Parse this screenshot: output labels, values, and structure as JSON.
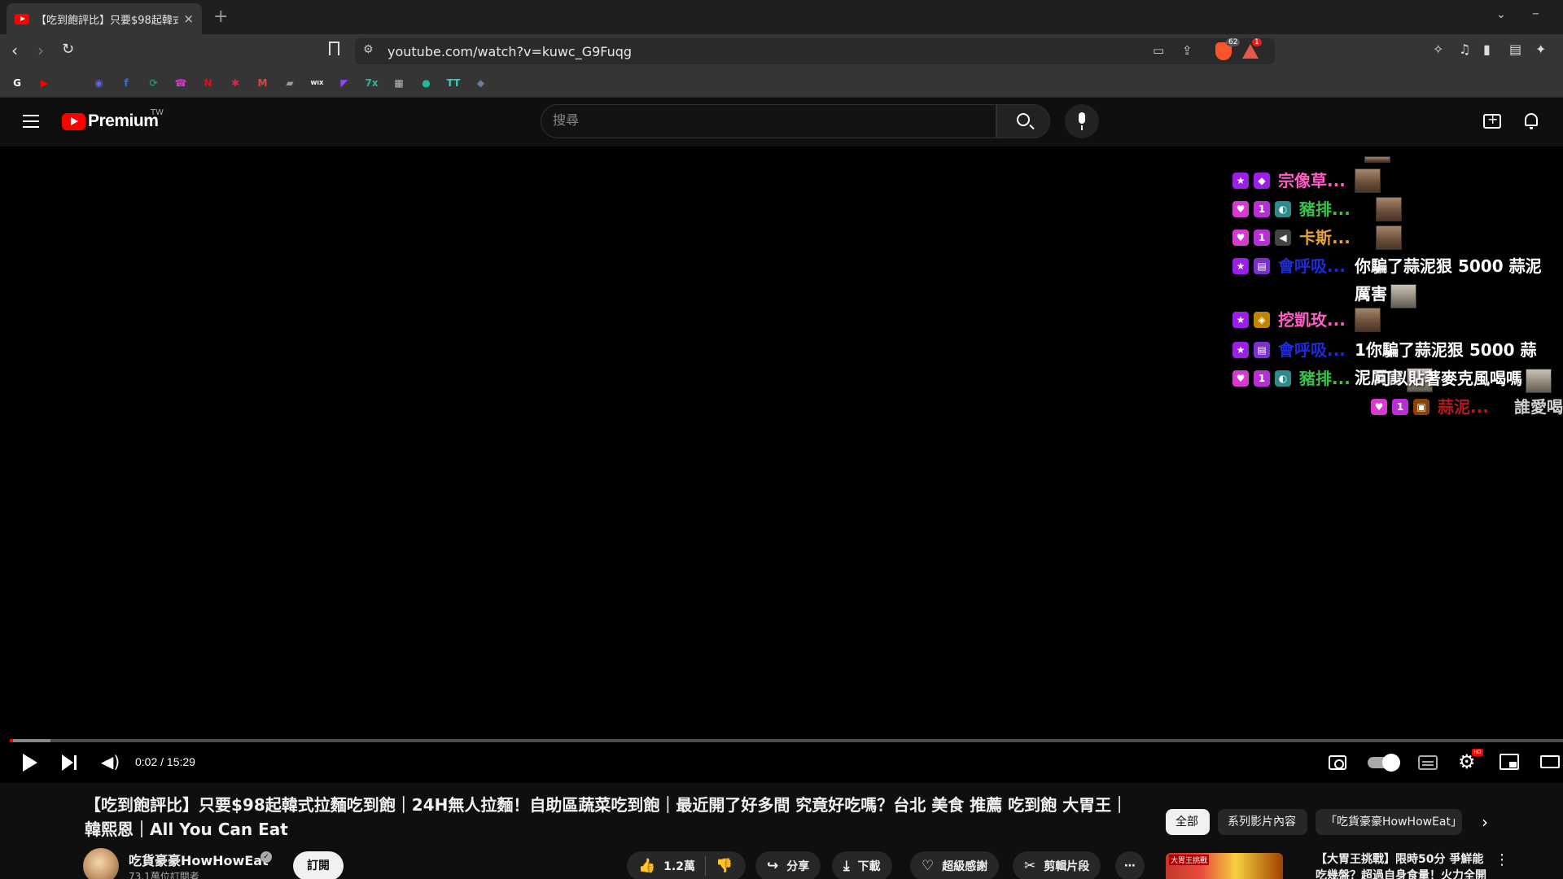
{
  "browser": {
    "tab_title": "【吃到飽評比】只要$98起韓式",
    "tab_close": "×",
    "new_tab": "+",
    "url": "youtube.com/watch?v=kuwc_G9Fuqg",
    "brave_shield_count": "62",
    "rewards_count": "1"
  },
  "bookmarks": [
    {
      "icon": "google-icon",
      "label": "G",
      "color": "#ffffff"
    },
    {
      "icon": "youtube-icon",
      "label": "▶",
      "color": "#ff0000"
    },
    {
      "icon": "app-icon",
      "label": "",
      "color": "#888888"
    },
    {
      "icon": "discord-icon",
      "label": "◉",
      "color": "#5865f2"
    },
    {
      "icon": "facebook-icon",
      "label": "f",
      "color": "#1877f2"
    },
    {
      "icon": "web-icon",
      "label": "⟳",
      "color": "#2f8f6f"
    },
    {
      "icon": "podcast-icon",
      "label": "☎",
      "color": "#d63acf"
    },
    {
      "icon": "netflix-icon",
      "label": "N",
      "color": "#e50914"
    },
    {
      "icon": "star-app-icon",
      "label": "✱",
      "color": "#e0244e"
    },
    {
      "icon": "gmail-icon",
      "label": "M",
      "color": "#ea4335"
    },
    {
      "icon": "drive-icon",
      "label": "▰",
      "color": "#9a9a9a"
    },
    {
      "icon": "wix-icon",
      "label": "WIX",
      "color": "#ffffff"
    },
    {
      "icon": "twitch-icon",
      "label": "◤",
      "color": "#9146ff"
    },
    {
      "icon": "tool-icon",
      "label": "7x",
      "color": "#1abc9c"
    },
    {
      "icon": "grid-icon",
      "label": "▦",
      "color": "#bbbbbb"
    },
    {
      "icon": "chat-icon",
      "label": "●",
      "color": "#1abc9c"
    },
    {
      "icon": "tt-icon",
      "label": "TT",
      "color": "#29d4c8"
    },
    {
      "icon": "shield-app-icon",
      "label": "◆",
      "color": "#6c7a9c"
    }
  ],
  "masthead": {
    "brand": "Premium",
    "region": "TW",
    "search_placeholder": "搜尋"
  },
  "chat": [
    {
      "badges": [
        "star",
        "diamond"
      ],
      "name": "宗像草...",
      "name_color": "pink",
      "message": "",
      "emote": true
    },
    {
      "badges": [
        "heart",
        "first",
        "pony"
      ],
      "name": "豬排...",
      "name_color": "green",
      "message": "",
      "emote": true
    },
    {
      "badges": [
        "heart",
        "first",
        "mute"
      ],
      "name": "卡斯...",
      "name_color": "orange",
      "message": "",
      "emote": true
    },
    {
      "badges": [
        "star",
        "sub"
      ],
      "name": "會呼吸...",
      "name_color": "blue",
      "message": "你騙了蒜泥狠 5000 蒜泥厲害",
      "emote": true
    },
    {
      "badges": [
        "star",
        "gold"
      ],
      "name": "挖凱玫...",
      "name_color": "pink",
      "message": "",
      "emote": true
    },
    {
      "badges": [
        "star",
        "sub"
      ],
      "name": "會呼吸...",
      "name_color": "blue",
      "message": "1你騙了蒜泥狠 5000 蒜泥厲害",
      "emote": true
    },
    {
      "badges": [
        "heart",
        "first",
        "pony"
      ],
      "name": "豬排...",
      "name_color": "green",
      "message": "可以貼著麥克風喝嗎",
      "emote": true
    },
    {
      "badges": [
        "heart",
        "first",
        "box"
      ],
      "name": "蒜泥...",
      "name_color": "red",
      "message": "誰愛喝詞",
      "emote": false
    }
  ],
  "player": {
    "time": "0:02 / 15:29",
    "progress_fraction": 0.002,
    "buffered_fraction": 0.026
  },
  "video": {
    "title": "【吃到飽評比】只要$98起韓式拉麵吃到飽｜24H無人拉麵！自助區蔬菜吃到飽｜最近開了好多間 究竟好吃嗎？台北 美食 推薦 吃到飽 大胃王｜韓熙恩｜All You Can Eat",
    "channel": "吃貨豪豪HowHowEat",
    "subscribers": "73.1萬位訂閱者",
    "subscribe": "訂閱",
    "likes": "1.2萬",
    "share": "分享",
    "download": "下載",
    "thanks": "超級感謝",
    "clip": "剪輯片段",
    "more": "⋯"
  },
  "chips": [
    "全部",
    "系列影片內容",
    "「吃貨豪豪HowHowEat」"
  ],
  "recommendation": {
    "title": "【大胃王挑戰】限時50分 爭鮮能吃幾盤？超過自身食量！火力全開",
    "thumb_tag": "大胃王挑戰"
  }
}
